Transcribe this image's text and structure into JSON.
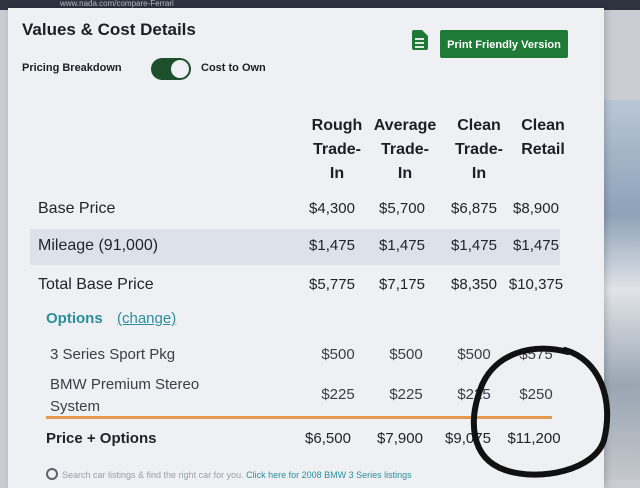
{
  "header": {
    "title": "Values & Cost Details",
    "print_label": "Print Friendly Version",
    "toggle_left": "Pricing Breakdown",
    "toggle_right": "Cost to Own"
  },
  "columns": [
    {
      "l1": "Rough",
      "l2": "Trade-",
      "l3": "In"
    },
    {
      "l1": "Average",
      "l2": "Trade-",
      "l3": "In"
    },
    {
      "l1": "Clean",
      "l2": "Trade-",
      "l3": "In"
    },
    {
      "l1": "Clean",
      "l2": "Retail",
      "l3": ""
    }
  ],
  "rows": [
    {
      "label": "Base Price",
      "values": [
        "$4,300",
        "$5,700",
        "$6,875",
        "$8,900"
      ]
    },
    {
      "label": "Mileage (91,000)",
      "values": [
        "$1,475",
        "$1,475",
        "$1,475",
        "$1,475"
      ]
    },
    {
      "label": "Total Base Price",
      "values": [
        "$5,775",
        "$7,175",
        "$8,350",
        "$10,375"
      ]
    }
  ],
  "options": {
    "title": "Options",
    "change": "(change)",
    "items": [
      {
        "l1": "3 Series Sport Pkg",
        "l2": "",
        "values": [
          "$500",
          "$500",
          "$500",
          "$575"
        ]
      },
      {
        "l1": "BMW Premium Stereo",
        "l2": "System",
        "values": [
          "$225",
          "$225",
          "$225",
          "$250"
        ]
      }
    ]
  },
  "total": {
    "label": "Price + Options",
    "values": [
      "$6,500",
      "$7,900",
      "$9,075",
      "$11,200"
    ]
  },
  "footer": {
    "text": "Search car listings & find the right car for you.",
    "link": "Click here for 2008 BMW 3 Series listings"
  },
  "browser": {
    "url": "www.nada.com/compare-Ferrari"
  }
}
